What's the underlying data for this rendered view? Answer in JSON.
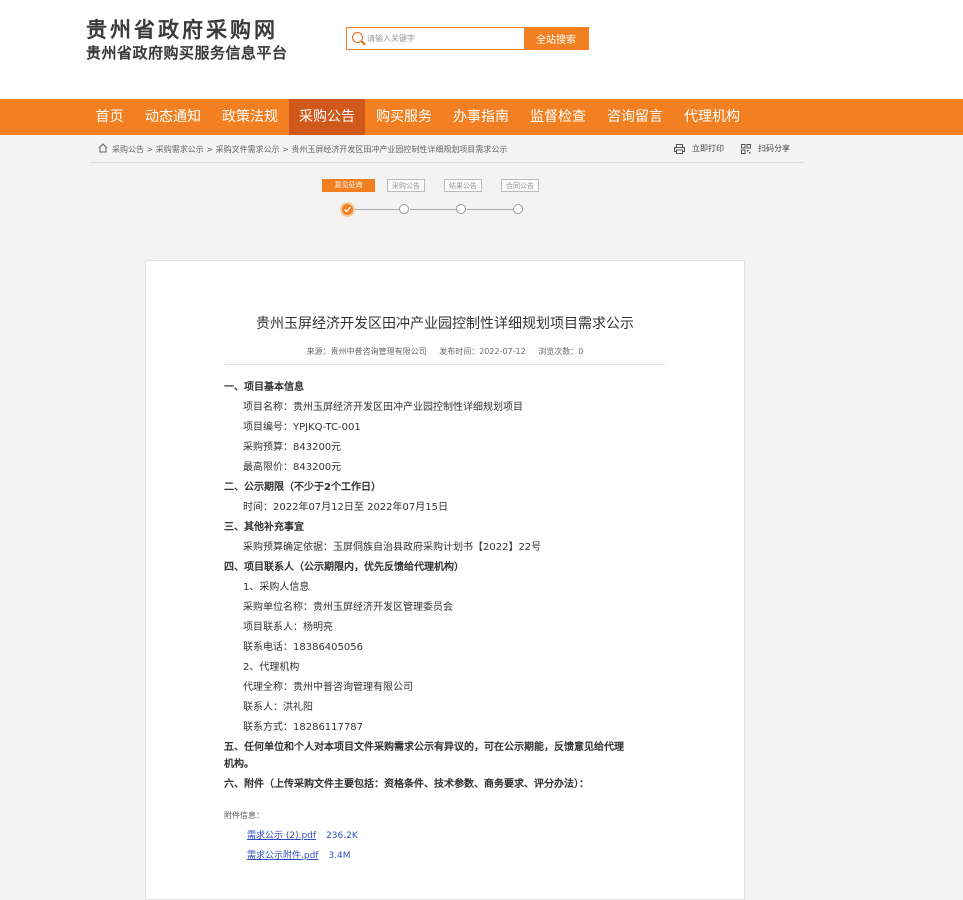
{
  "site": {
    "title": "贵州省政府采购网",
    "subtitle": "贵州省政府购买服务信息平台"
  },
  "search": {
    "placeholder": "请输入关键字",
    "button": "全站搜索"
  },
  "nav": [
    "首页",
    "动态通知",
    "政策法规",
    "采购公告",
    "购买服务",
    "办事指南",
    "监督检查",
    "咨询留言",
    "代理机构"
  ],
  "nav_active": "采购公告",
  "breadcrumb": "采购公告 > 采购需求公示 > 采购文件需求公示 > 贵州玉屏经济开发区田冲产业园控制性详细规划项目需求公示",
  "tools": {
    "print": "立即打印",
    "share": "扫码分享"
  },
  "steps": [
    "意见征询",
    "采购公告",
    "结果公告",
    "合同公告"
  ],
  "article": {
    "title": "贵州玉屏经济开发区田冲产业园控制性详细规划项目需求公示",
    "source": "来源：贵州中普咨询管理有限公司",
    "date": "发布时间：2022-07-12",
    "views": "浏览次数：0",
    "lines": [
      {
        "text": "一、项目基本信息",
        "bold": true
      },
      {
        "text": "项目名称：贵州玉屏经济开发区田冲产业园控制性详细规划项目",
        "bold": false
      },
      {
        "text": "项目编号：YPJKQ-TC-001",
        "bold": false
      },
      {
        "text": "采购预算：843200元",
        "bold": false
      },
      {
        "text": "最高限价：843200元",
        "bold": false
      },
      {
        "text": "二、公示期限（不少于2个工作日）",
        "bold": true
      },
      {
        "text": "时间：2022年07月12日至 2022年07月15日",
        "bold": false
      },
      {
        "text": "三、其他补充事宜",
        "bold": true
      },
      {
        "text": "采购预算确定依据：玉屏侗族自治县政府采购计划书【2022】22号",
        "bold": false
      },
      {
        "text": "四、项目联系人（公示期限内，优先反馈给代理机构）",
        "bold": true
      },
      {
        "text": "1、采购人信息",
        "bold": false
      },
      {
        "text": "采购单位名称：贵州玉屏经济开发区管理委员会",
        "bold": false
      },
      {
        "text": "项目联系人：杨明亮",
        "bold": false
      },
      {
        "text": "联系电话：18386405056",
        "bold": false
      },
      {
        "text": "2、代理机构",
        "bold": false
      },
      {
        "text": "代理全称：贵州中普咨询管理有限公司",
        "bold": false
      },
      {
        "text": "联系人：洪礼阳",
        "bold": false
      },
      {
        "text": "联系方式：18286117787",
        "bold": false
      },
      {
        "text": "五、任何单位和个人对本项目文件采购需求公示有异议的，可在公示期能，反馈意见给代理",
        "bold": true
      },
      {
        "text": "机构。",
        "bold": true
      },
      {
        "text": "六、附件（上传采购文件主要包括：资格条件、技术参数、商务要求、评分办法）：",
        "bold": true
      }
    ],
    "attachments_label": "附件信息：",
    "attachments": [
      {
        "name": "需求公示 (2).pdf",
        "size": "236.2K"
      },
      {
        "name": "需求公示附件.pdf",
        "size": "3.4M"
      }
    ]
  }
}
